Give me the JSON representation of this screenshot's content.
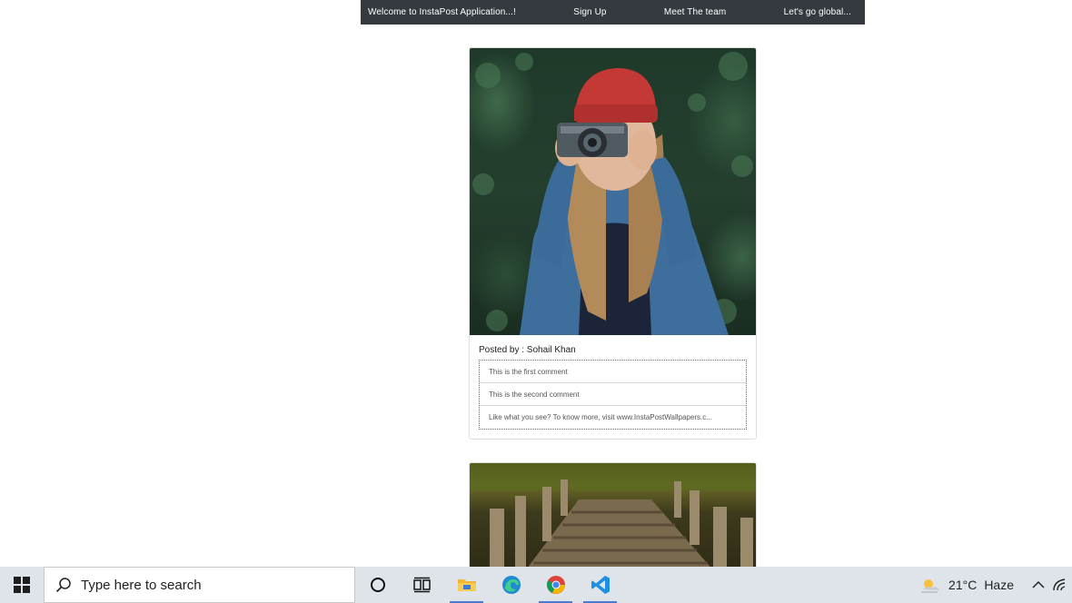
{
  "navbar": {
    "brand": "Welcome to InstaPost Application...!",
    "links": [
      "Sign Up",
      "Meet The team",
      "Let's go global..."
    ]
  },
  "posts": [
    {
      "posted_by": "Posted by : Sohail Khan",
      "comments": [
        "This is the first comment",
        "This is the second comment",
        "Like what you see? To know more, visit www.InstaPostWallpapers.c..."
      ]
    }
  ],
  "taskbar": {
    "search_placeholder": "Type here to search",
    "weather_temp": "21°C",
    "weather_desc": "Haze",
    "pinned_icons": [
      "cortana-icon",
      "task-view-icon",
      "file-explorer-icon",
      "edge-icon",
      "chrome-icon",
      "vscode-icon"
    ]
  }
}
